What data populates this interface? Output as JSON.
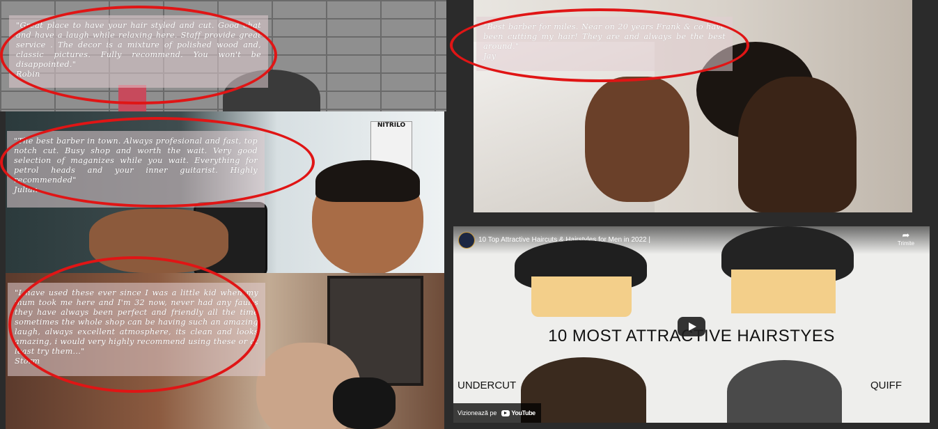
{
  "reviews": [
    {
      "text": "\"Great place to have your hair styled and cut. Good chat and have a laugh while relaxing here. Staff provide great service . The decor is a mixture of polished wood and, classic pictures. Fully recommend. You won't be disappointed.\"",
      "author": "Robin"
    },
    {
      "text": "\"Best barber for miles. Near on 20 years Frank & co have been cutting my hair! They are and always be the best around.\"",
      "author": "Jay"
    },
    {
      "text": "\"The best barber in town. Always profesional and fast, top notch cut. Busy shop and worth the wait. Very good selection of maganizes while you wait. Everything for petrol heads and your inner guitarist. Highly recommended\"",
      "author": "Julian"
    },
    {
      "text": "\"I have used these ever since I was a little kid when my mum took me here and I'm 32 now, never had any faults they have always been perfect and friendly all the time sometimes the whole shop can be having such an amazing laugh, always excellent atmosphere, its clean and looks amazing, i would very highly recommend using these or at least try them...\"",
      "author": "Storm"
    }
  ],
  "signs": {
    "nitrilo": "NITRILO",
    "nitrilo_side": "NITRILO"
  },
  "video": {
    "title": "10 Top Attractive Haircuts & Hairstyles for Men in 2022 |",
    "share_label": "Trimite",
    "headline": "10 MOST ATTRACTIVE HAIRSTYES",
    "label_left": "UNDERCUT",
    "label_right": "QUIFF",
    "watch_on": "Vizionează pe",
    "youtube": "YouTube"
  },
  "colors": {
    "annotation": "#e01515",
    "play": "#1f1f1f",
    "skin": "#f3cf8a"
  }
}
